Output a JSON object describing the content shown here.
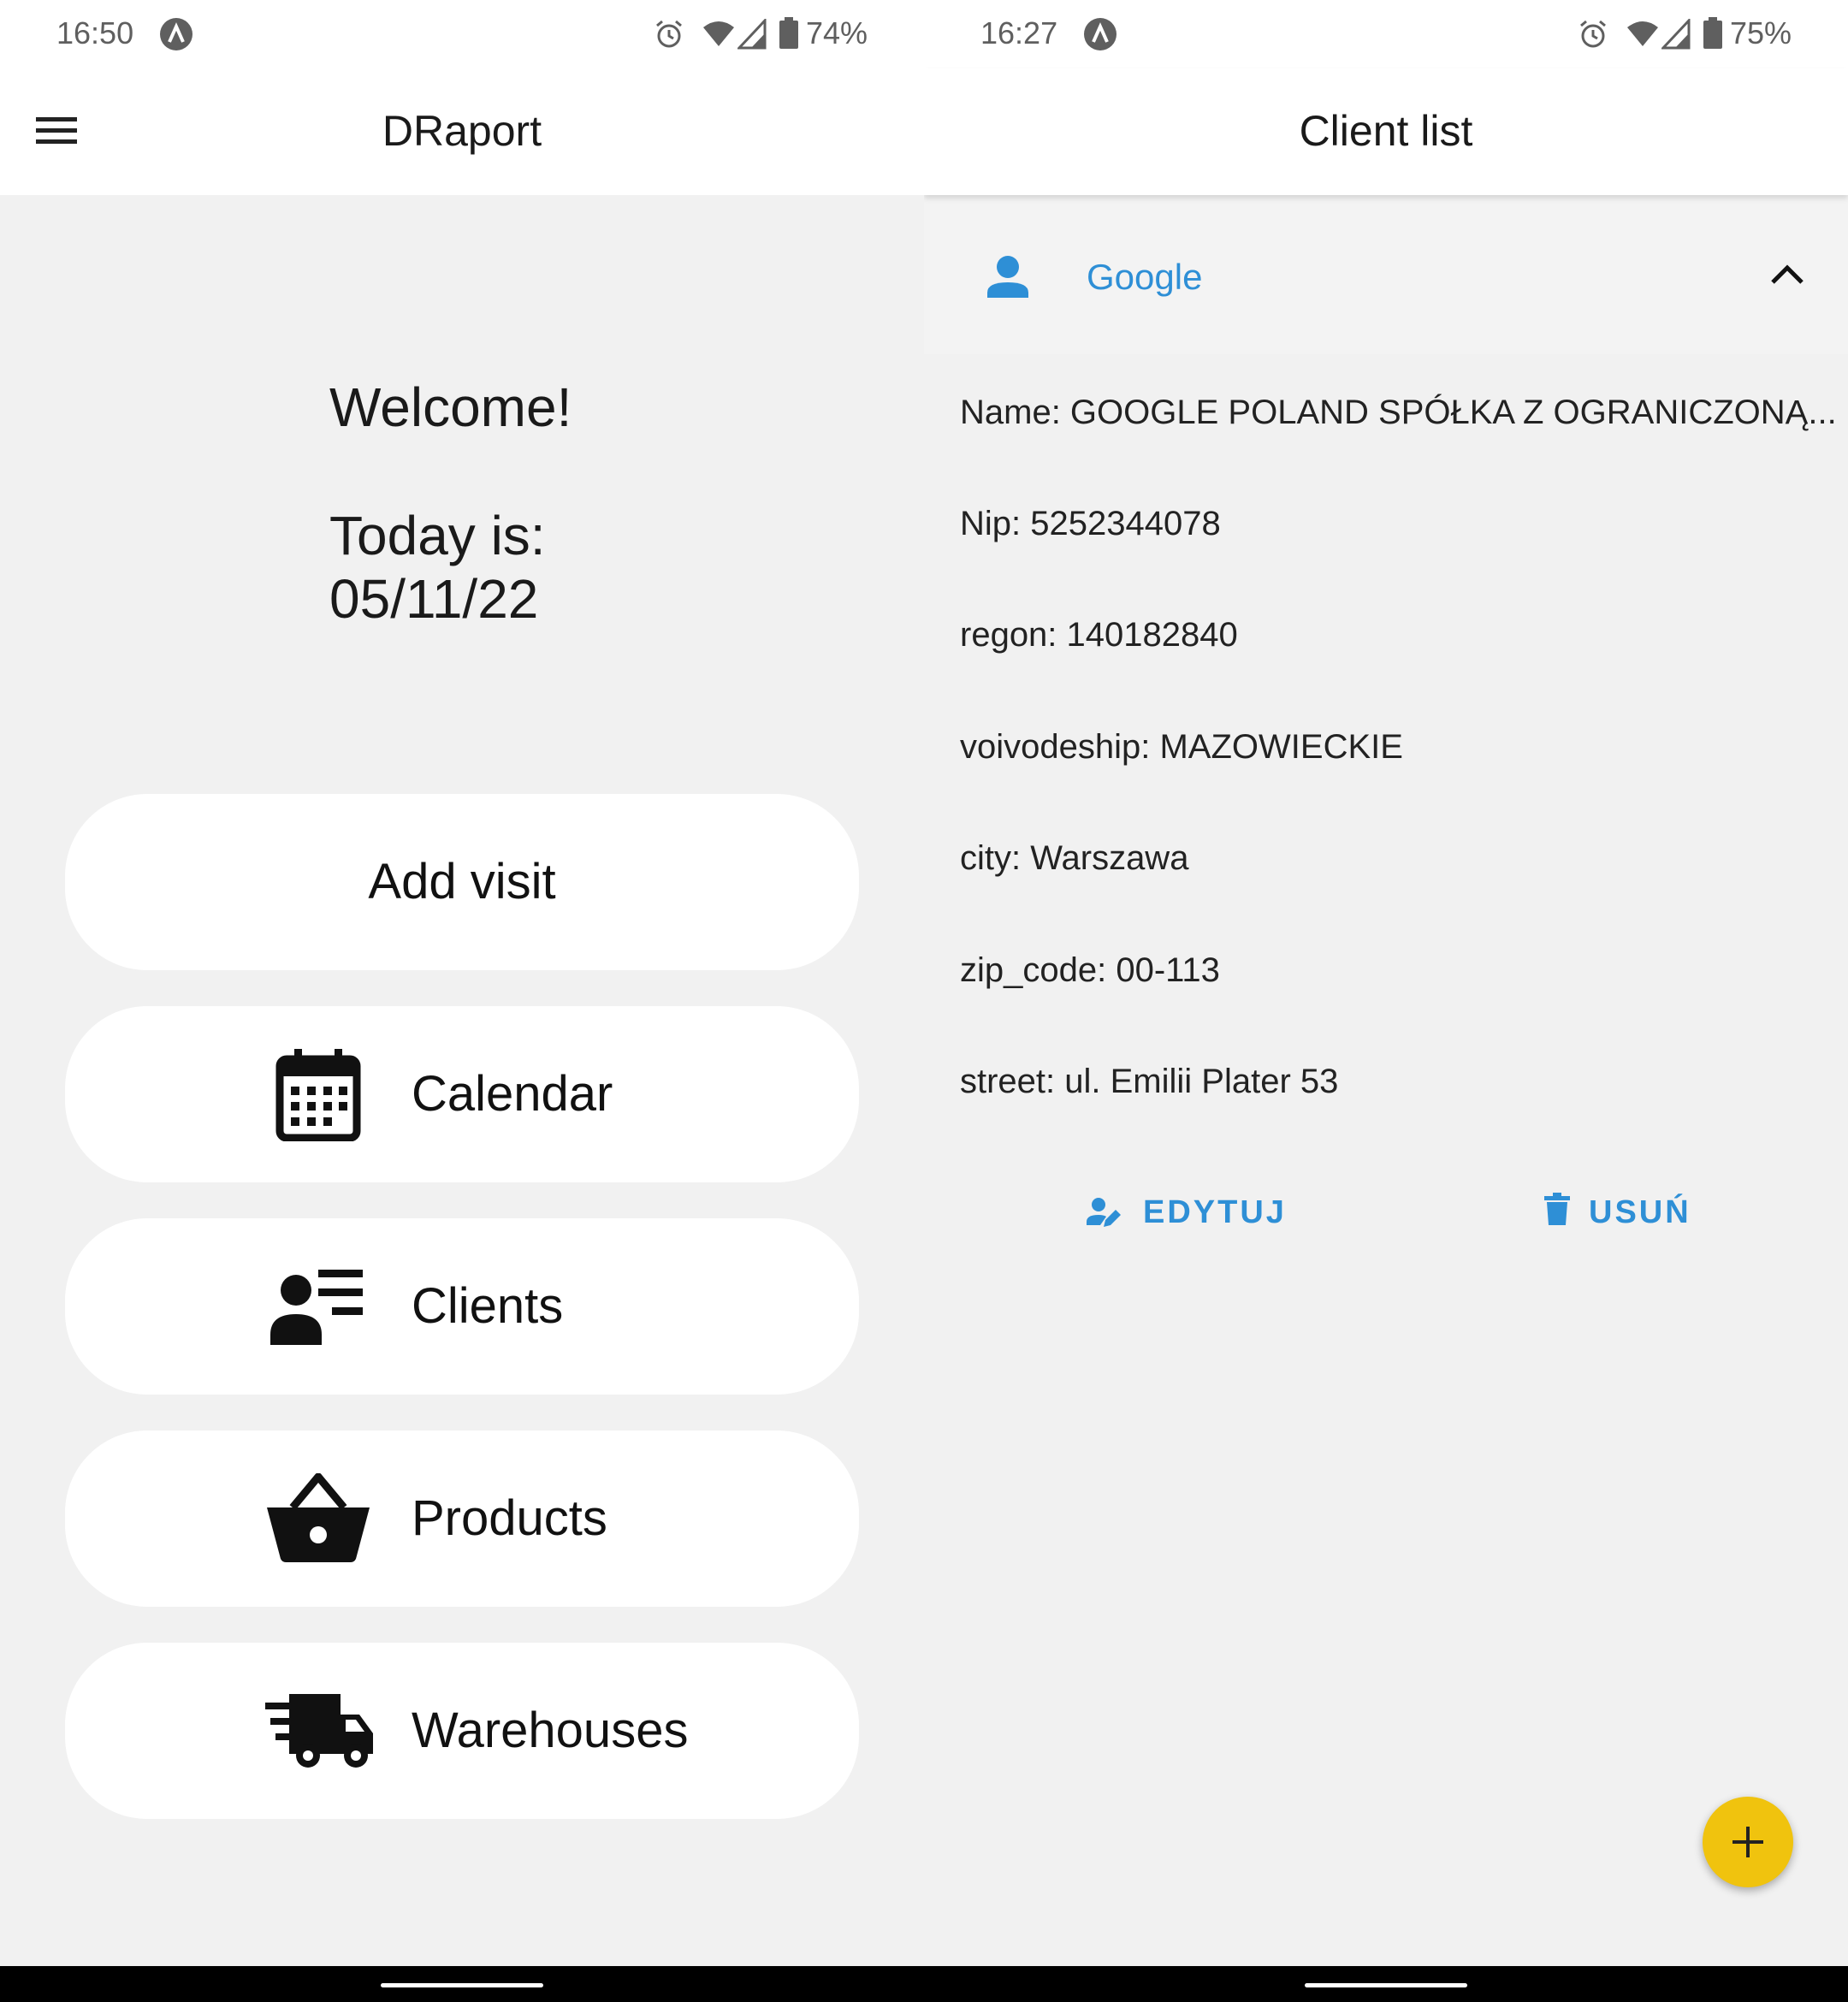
{
  "left": {
    "status": {
      "time": "16:50",
      "battery": "74%"
    },
    "appbar": {
      "title": "DRaport"
    },
    "welcome": "Welcome!",
    "today_label": "Today is:",
    "date": "05/11/22",
    "buttons": {
      "add_visit": "Add visit",
      "calendar": "Calendar",
      "clients": "Clients",
      "products": "Products",
      "warehouses": "Warehouses"
    }
  },
  "right": {
    "status": {
      "time": "16:27",
      "battery": "75%"
    },
    "appbar": {
      "title": "Client list"
    },
    "client": {
      "name": "Google",
      "details": [
        "Name: GOOGLE POLAND SPÓŁKA Z OGRANICZONĄ...",
        "Nip: 5252344078",
        "regon: 140182840",
        "voivodeship: MAZOWIECKIE",
        "city: Warszawa",
        "zip_code: 00-113",
        "street: ul. Emilii Plater 53"
      ],
      "edit_label": "EDYTUJ",
      "delete_label": "USUŃ"
    }
  },
  "colors": {
    "accent": "#2e8fd6",
    "fab": "#f0c30e",
    "background": "#f1f1f1"
  }
}
